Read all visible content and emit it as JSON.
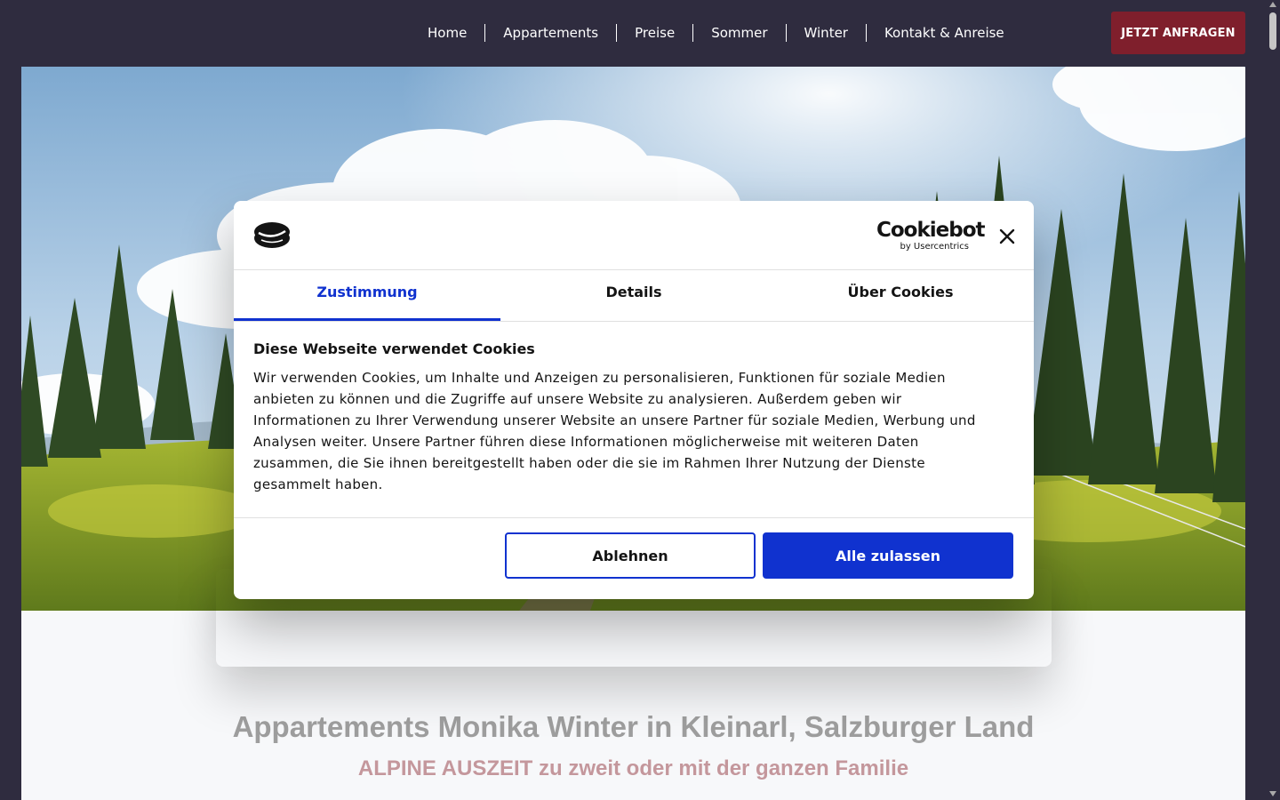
{
  "nav": {
    "items": [
      "Home",
      "Appartements",
      "Preise",
      "Sommer",
      "Winter",
      "Kontakt & Anreise"
    ],
    "cta_label": "JETZT ANFRAGEN"
  },
  "hero": {
    "image": "alpine-meadow-with-fir-trees-photo"
  },
  "content": {
    "title": "Appartements Monika Winter in Kleinarl, Salzburger Land",
    "subtitle": "ALPINE AUSZEIT zu zweit oder mit der ganzen Familie"
  },
  "cookie_dialog": {
    "brand_name": "Cookiebot",
    "brand_sub": "by Usercentrics",
    "tabs": [
      "Zustimmung",
      "Details",
      "Über Cookies"
    ],
    "active_tab": 0,
    "heading": "Diese Webseite verwendet Cookies",
    "body": "Wir verwenden Cookies, um Inhalte und Anzeigen zu personalisieren, Funktionen für soziale Medien anbieten zu können und die Zugriffe auf unsere Website zu analysieren. Außerdem geben wir Informationen zu Ihrer Verwendung unserer Website an unsere Partner für soziale Medien, Werbung und Analysen weiter. Unsere Partner führen diese Informationen möglicherweise mit weiteren Daten zusammen, die Sie ihnen bereitgestellt haben oder die sie im Rahmen Ihrer Nutzung der Dienste gesammelt haben.",
    "decline_label": "Ablehnen",
    "accept_label": "Alle zulassen"
  },
  "colors": {
    "header_bg": "#2f2c3f",
    "cta_bg": "#7f1f2c",
    "accent_blue": "#1032cf",
    "title_gray": "#9e9e9e",
    "subtitle_rose": "#c4979c"
  }
}
